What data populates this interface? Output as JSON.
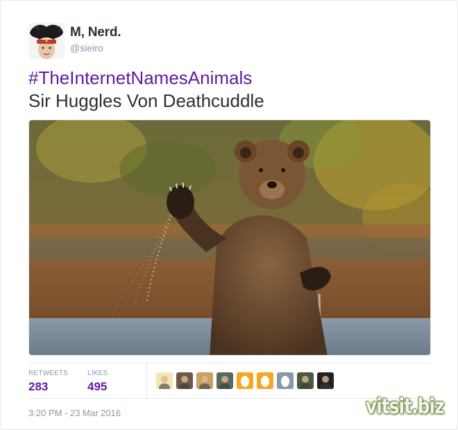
{
  "tweet": {
    "display_name": "M, Nerd.",
    "handle": "@sieiro",
    "hashtag": "#TheInternetNamesAnimals",
    "text": "Sir Huggles Von Deathcuddle",
    "timestamp": "3:20 PM - 23 Mar 2016"
  },
  "stats": {
    "retweets_label": "RETWEETS",
    "retweets_value": "283",
    "likes_label": "LIKES",
    "likes_value": "495"
  },
  "likers": [
    {
      "icon": "user-avatar-icon",
      "color": "#f5e6b0"
    },
    {
      "icon": "user-avatar-icon",
      "color": "#6b5a4a"
    },
    {
      "icon": "user-avatar-icon",
      "color": "#c9a060"
    },
    {
      "icon": "user-avatar-icon",
      "color": "#5a6a5a"
    },
    {
      "icon": "default-egg-icon",
      "color": "#f5a623"
    },
    {
      "icon": "default-egg-icon",
      "color": "#f5a623"
    },
    {
      "icon": "default-egg-icon",
      "color": "#8899a6"
    },
    {
      "icon": "user-avatar-icon",
      "color": "#4a5a3a"
    },
    {
      "icon": "user-avatar-icon",
      "color": "#222222"
    }
  ],
  "watermark": "vitsit.biz",
  "colors": {
    "accent": "#5e1aa0",
    "text": "#292f33",
    "muted": "#8899a6",
    "border": "#e1e8ed"
  }
}
